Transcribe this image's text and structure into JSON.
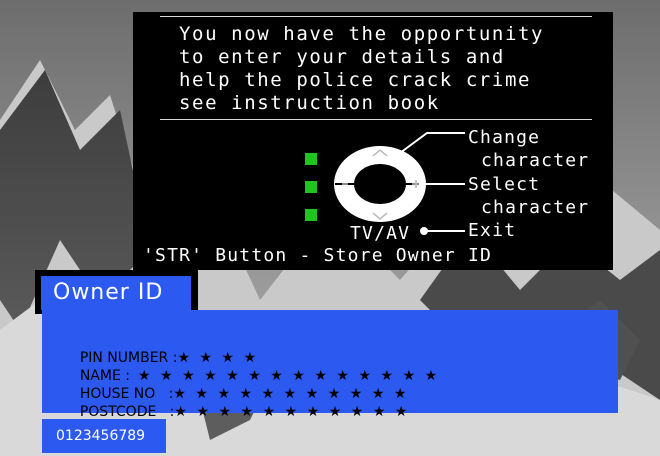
{
  "info": {
    "message_lines": [
      "You now have the opportunity",
      "to enter your details and",
      "help the police crack crime",
      "see instruction book"
    ],
    "remote_labels": {
      "change_1": "Change",
      "change_2": "character",
      "select_1": "Select",
      "select_2": "character",
      "exit": "Exit",
      "tvav": "TV/AV"
    },
    "store_line": "'STR' Button - Store Owner ID"
  },
  "owner": {
    "title": "Owner ID"
  },
  "fields": {
    "pin_label": "PIN NUMBER :",
    "pin_value": "★★★★",
    "name_label": "NAME :",
    "name_value": "★★★★★★★★★★★★★★",
    "house_label": "HOUSE NO   :",
    "house_value": "★★★★★★★★★★★",
    "postcode_label": "POSTCODE   :",
    "postcode_value": "★★★★★★★★★★★"
  },
  "digits": {
    "text": "0123456789"
  },
  "colors": {
    "panel_blue": "#2c59f0",
    "indicator_green": "#21c321",
    "info_background": "#000000"
  }
}
